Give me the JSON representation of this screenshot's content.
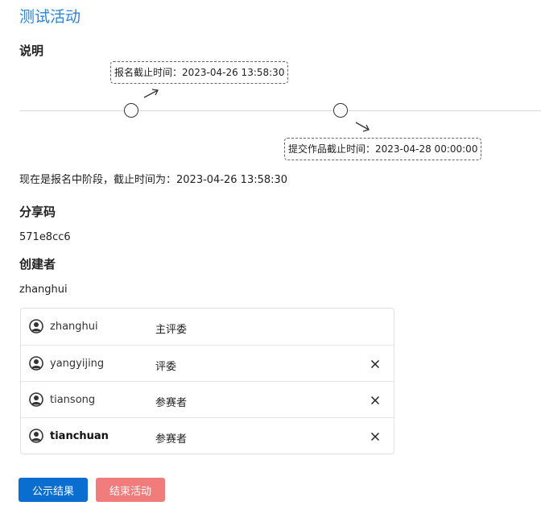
{
  "page": {
    "title": "测试活动"
  },
  "description": {
    "heading": "说明",
    "timeline": [
      {
        "label": "报名截止时间：2023-04-26 13:58:30"
      },
      {
        "label": "提交作品截止时间：2023-04-28 00:00:00"
      }
    ],
    "status_text": "现在是报名中阶段，截止时间为：2023-04-26 13:58:30"
  },
  "share": {
    "heading": "分享码",
    "code": "571e8cc6"
  },
  "creator": {
    "heading": "创建者",
    "name": "zhanghui"
  },
  "members": [
    {
      "name": "zhanghui",
      "role": "主评委",
      "removable": false
    },
    {
      "name": "yangyijing",
      "role": "评委",
      "removable": true
    },
    {
      "name": "tiansong",
      "role": "参赛者",
      "removable": true
    },
    {
      "name": "tianchuan",
      "role": "参赛者",
      "removable": true
    }
  ],
  "actions": {
    "publish_label": "公示结果",
    "end_label": "结束活动"
  },
  "colors": {
    "title": "#2b83dc",
    "primary": "#0a6ed1",
    "danger": "#f07c7c"
  }
}
